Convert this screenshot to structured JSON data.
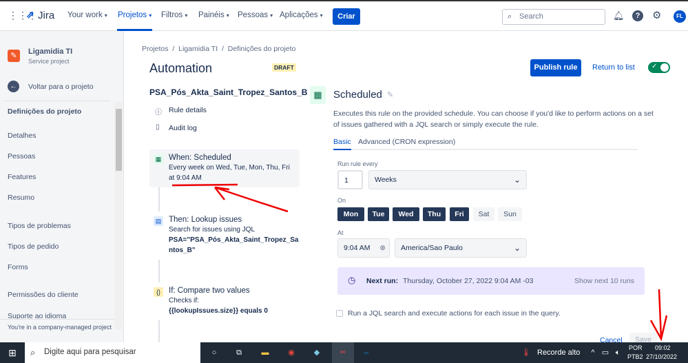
{
  "topnav": {
    "app": "Jira",
    "items": [
      "Your work",
      "Projetos",
      "Filtros",
      "Painéis",
      "Pessoas",
      "Aplicações"
    ],
    "create": "Criar",
    "search_placeholder": "Search",
    "avatar": "FL"
  },
  "sidebar": {
    "project_name": "Ligamidia TI",
    "project_type": "Service project",
    "back": "Voltar para o projeto",
    "section": "Definições do projeto",
    "items": [
      "Detalhes",
      "Pessoas",
      "Features",
      "Resumo",
      "Tipos de problemas",
      "Tipos de pedido",
      "Forms",
      "Permissões do cliente",
      "Suporte ao idioma"
    ],
    "footer": "You're in a company-managed project"
  },
  "breadcrumb": [
    "Projetos",
    "Ligamidia TI",
    "Definições do projeto"
  ],
  "page": {
    "title": "Automation",
    "badge": "DRAFT",
    "rule_name": "PSA_Pós_Akta_Saint_Tropez_Santos_B",
    "rule_details": "Rule details",
    "audit_log": "Audit log",
    "publish": "Publish rule",
    "return": "Return to list"
  },
  "steps": [
    {
      "title": "When: Scheduled",
      "desc1": "Every week on Wed, Tue, Mon, Thu, Fri",
      "desc2": "at 9:04 AM"
    },
    {
      "title": "Then: Lookup issues",
      "desc1": "Search for issues using JQL",
      "desc2": "PSA=\"PSA_Pós_Akta_Saint_Tropez_Sa",
      "desc3": "ntos_B\""
    },
    {
      "title": "If: Compare two values",
      "desc1": "Checks if:",
      "desc2": "{{lookupIssues.size}} equals 0"
    }
  ],
  "detail": {
    "title": "Scheduled",
    "description": "Executes this rule on the provided schedule. You can choose if you'd like to perform actions on a set of issues gathered with a JQL search or simply execute the rule.",
    "tabs": [
      "Basic",
      "Advanced (CRON expression)"
    ],
    "run_every_label": "Run rule every",
    "run_every_value": "1",
    "period": "Weeks",
    "on_label": "On",
    "days": [
      {
        "d": "Mon",
        "on": true
      },
      {
        "d": "Tue",
        "on": true
      },
      {
        "d": "Wed",
        "on": true
      },
      {
        "d": "Thu",
        "on": true
      },
      {
        "d": "Fri",
        "on": true
      },
      {
        "d": "Sat",
        "on": false
      },
      {
        "d": "Sun",
        "on": false
      }
    ],
    "at_label": "At",
    "time": "9:04 AM",
    "timezone": "America/Sao Paulo",
    "next_run_label": "Next run:",
    "next_run": "Thursday, October 27, 2022 9:04 AM -03",
    "show_next": "Show next 10 runs",
    "jql_checkbox": "Run a JQL search and execute actions for each issue in the query.",
    "cancel": "Cancel",
    "save": "Save"
  },
  "taskbar": {
    "search": "Digite aqui para pesquisar",
    "weather": "Recorde alto",
    "lang1": "POR",
    "lang2": "PTB2",
    "time": "09:02",
    "date": "27/10/2022"
  }
}
